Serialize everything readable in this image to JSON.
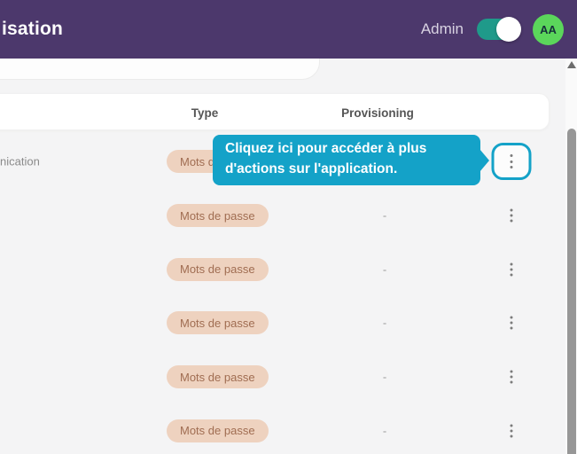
{
  "header": {
    "title": "isation",
    "admin_label": "Admin",
    "admin_toggle_state": "on",
    "avatar_initials": "AA"
  },
  "table": {
    "columns": {
      "type": "Type",
      "provisioning": "Provisioning"
    },
    "rows": [
      {
        "name": "nication",
        "type_badge": "Mots de passe",
        "provisioning": "-",
        "highlighted": true
      },
      {
        "name": "",
        "type_badge": "Mots de passe",
        "provisioning": "-",
        "highlighted": false
      },
      {
        "name": "",
        "type_badge": "Mots de passe",
        "provisioning": "-",
        "highlighted": false
      },
      {
        "name": "",
        "type_badge": "Mots de passe",
        "provisioning": "-",
        "highlighted": false
      },
      {
        "name": "",
        "type_badge": "Mots de passe",
        "provisioning": "-",
        "highlighted": false
      },
      {
        "name": "",
        "type_badge": "Mots de passe",
        "provisioning": "-",
        "highlighted": false
      }
    ]
  },
  "tooltip": {
    "text": "Cliquez ici pour accéder à plus d'actions sur l'application."
  },
  "colors": {
    "header_bg": "#4c386c",
    "accent": "#14a2c8",
    "toggle_on": "#1f9a8a",
    "avatar_bg": "#5bd65b",
    "badge_bg": "#eed2bf",
    "badge_text": "#a06d52",
    "page_bg": "#f4f4f5"
  }
}
